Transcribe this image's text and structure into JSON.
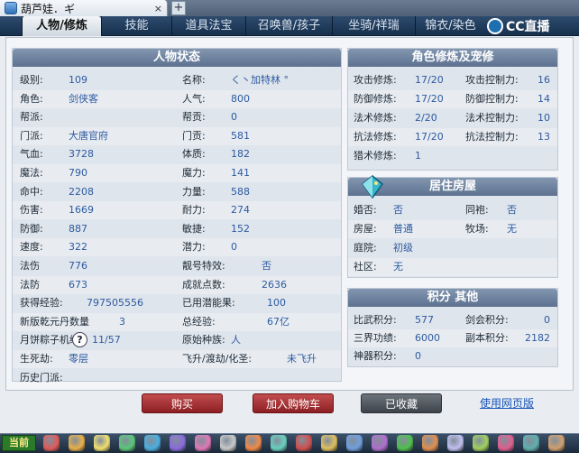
{
  "browser": {
    "tab_title": "葫芦娃．ギ",
    "close": "×",
    "new_tab": "+"
  },
  "game_tabs": [
    "人物/修炼",
    "技能",
    "道具法宝",
    "召唤兽/孩子",
    "坐骑/祥瑞",
    "锦衣/染色"
  ],
  "logo": {
    "text": "CC直播"
  },
  "status": {
    "title": "人物状态",
    "rows": [
      {
        "l1": "级别:",
        "v1": "109",
        "l2": "名称:",
        "v2": "く丶加特林 °"
      },
      {
        "l1": "角色:",
        "v1": "剑侠客",
        "l2": "人气:",
        "v2": "800"
      },
      {
        "l1": "帮派:",
        "v1": "",
        "l2": "帮贡:",
        "v2": "0"
      },
      {
        "l1": "门派:",
        "v1": "大唐官府",
        "l2": "门贡:",
        "v2": "581"
      },
      {
        "l1": "气血:",
        "v1": "3728",
        "l2": "体质:",
        "v2": "182"
      },
      {
        "l1": "魔法:",
        "v1": "790",
        "l2": "魔力:",
        "v2": "141"
      },
      {
        "l1": "命中:",
        "v1": "2208",
        "l2": "力量:",
        "v2": "588"
      },
      {
        "l1": "伤害:",
        "v1": "1669",
        "l2": "耐力:",
        "v2": "274"
      },
      {
        "l1": "防御:",
        "v1": "887",
        "l2": "敏捷:",
        "v2": "152"
      },
      {
        "l1": "速度:",
        "v1": "322",
        "l2": "潜力:",
        "v2": "0"
      },
      {
        "l1": "法伤",
        "v1": "776",
        "l2": "靓号特效:",
        "v2": "否"
      },
      {
        "l1": "法防",
        "v1": "673",
        "l2": "成就点数:",
        "v2": "2636"
      },
      {
        "l1": "获得经验:",
        "v1": "797505556",
        "l2": "已用潜能果:",
        "v2": "100"
      },
      {
        "l1": "新版乾元丹数量",
        "v1": "3",
        "l2": "总经验:",
        "v2": "67亿"
      },
      {
        "l1": "月饼粽子机缘:",
        "v1": "11/57",
        "l2": "原始种族:",
        "v2": "人"
      },
      {
        "l1": "生死劫:",
        "v1": "零层",
        "l2": "飞升/渡劫/化圣:",
        "v2": "未飞升"
      },
      {
        "l1": "历史门派:",
        "v1": "",
        "l2": "",
        "v2": ""
      }
    ],
    "help": "?"
  },
  "cultivation": {
    "title": "角色修炼及宠修",
    "rows": [
      {
        "l1": "攻击修炼:",
        "v1": "17/20",
        "l2": "攻击控制力:",
        "v2": "16"
      },
      {
        "l1": "防御修炼:",
        "v1": "17/20",
        "l2": "防御控制力:",
        "v2": "14"
      },
      {
        "l1": "法术修炼:",
        "v1": "2/20",
        "l2": "法术控制力:",
        "v2": "10"
      },
      {
        "l1": "抗法修炼:",
        "v1": "17/20",
        "l2": "抗法控制力:",
        "v2": "13"
      },
      {
        "l1": "猎术修炼:",
        "v1": "1",
        "l2": "",
        "v2": ""
      }
    ]
  },
  "house": {
    "title": "居住房屋",
    "rows": [
      {
        "l1": "婚否:",
        "v1": "否",
        "l2": "同袍:",
        "v2": "否"
      },
      {
        "l1": "房屋:",
        "v1": "普通",
        "l2": "牧场:",
        "v2": "无"
      },
      {
        "l1": "庭院:",
        "v1": "初级",
        "l2": "",
        "v2": ""
      },
      {
        "l1": "社区:",
        "v1": "无",
        "l2": "",
        "v2": ""
      }
    ]
  },
  "points": {
    "title": "积分 其他",
    "rows": [
      {
        "l1": "比武积分:",
        "v1": "577",
        "l2": "剑会积分:",
        "v2": "0"
      },
      {
        "l1": "三界功绩:",
        "v1": "6000",
        "l2": "副本积分:",
        "v2": "2182"
      },
      {
        "l1": "神器积分:",
        "v1": "0",
        "l2": "",
        "v2": ""
      }
    ]
  },
  "buttons": {
    "buy": "购买",
    "cart": "加入购物车",
    "fav": "已收藏",
    "web": "使用网页版"
  },
  "taskbar": {
    "current": "当前"
  }
}
